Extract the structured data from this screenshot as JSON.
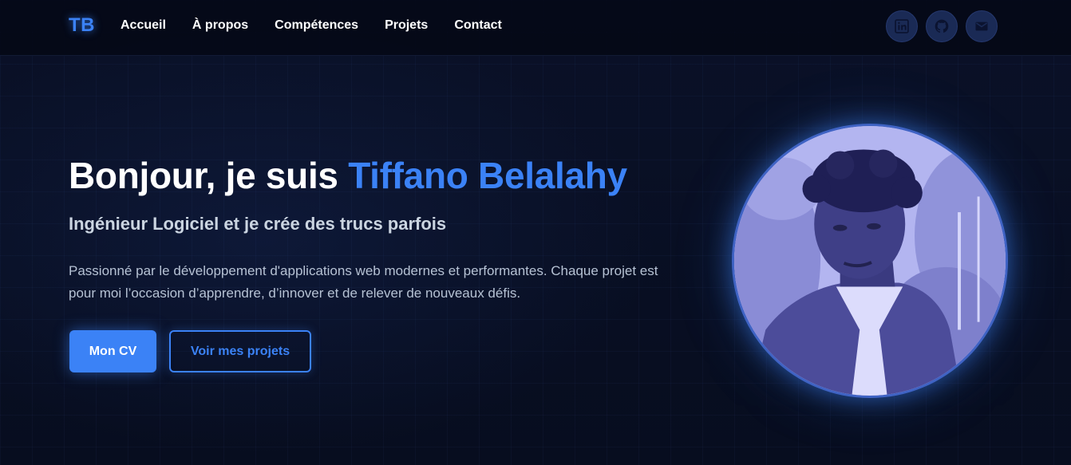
{
  "nav": {
    "logo": "TB",
    "links": [
      "Accueil",
      "À propos",
      "Compétences",
      "Projets",
      "Contact"
    ],
    "socials": [
      {
        "icon": "linkedin-icon"
      },
      {
        "icon": "github-icon"
      },
      {
        "icon": "mail-icon"
      }
    ]
  },
  "hero": {
    "greeting": "Bonjour, je suis ",
    "name": "Tiffano Belalahy",
    "subtitle": "Ingénieur Logiciel et je crée des trucs parfois",
    "description": "Passionné par le développement d'applications web modernes et performantes. Chaque projet est pour moi l’occasion d’apprendre, d’innover et de relever de nouveaux défis.",
    "cv_button": "Mon CV",
    "projects_button": "Voir mes projets"
  },
  "colors": {
    "accent": "#3b82f6",
    "background": "#070d1f",
    "icon_bg": "#1a2a55"
  }
}
